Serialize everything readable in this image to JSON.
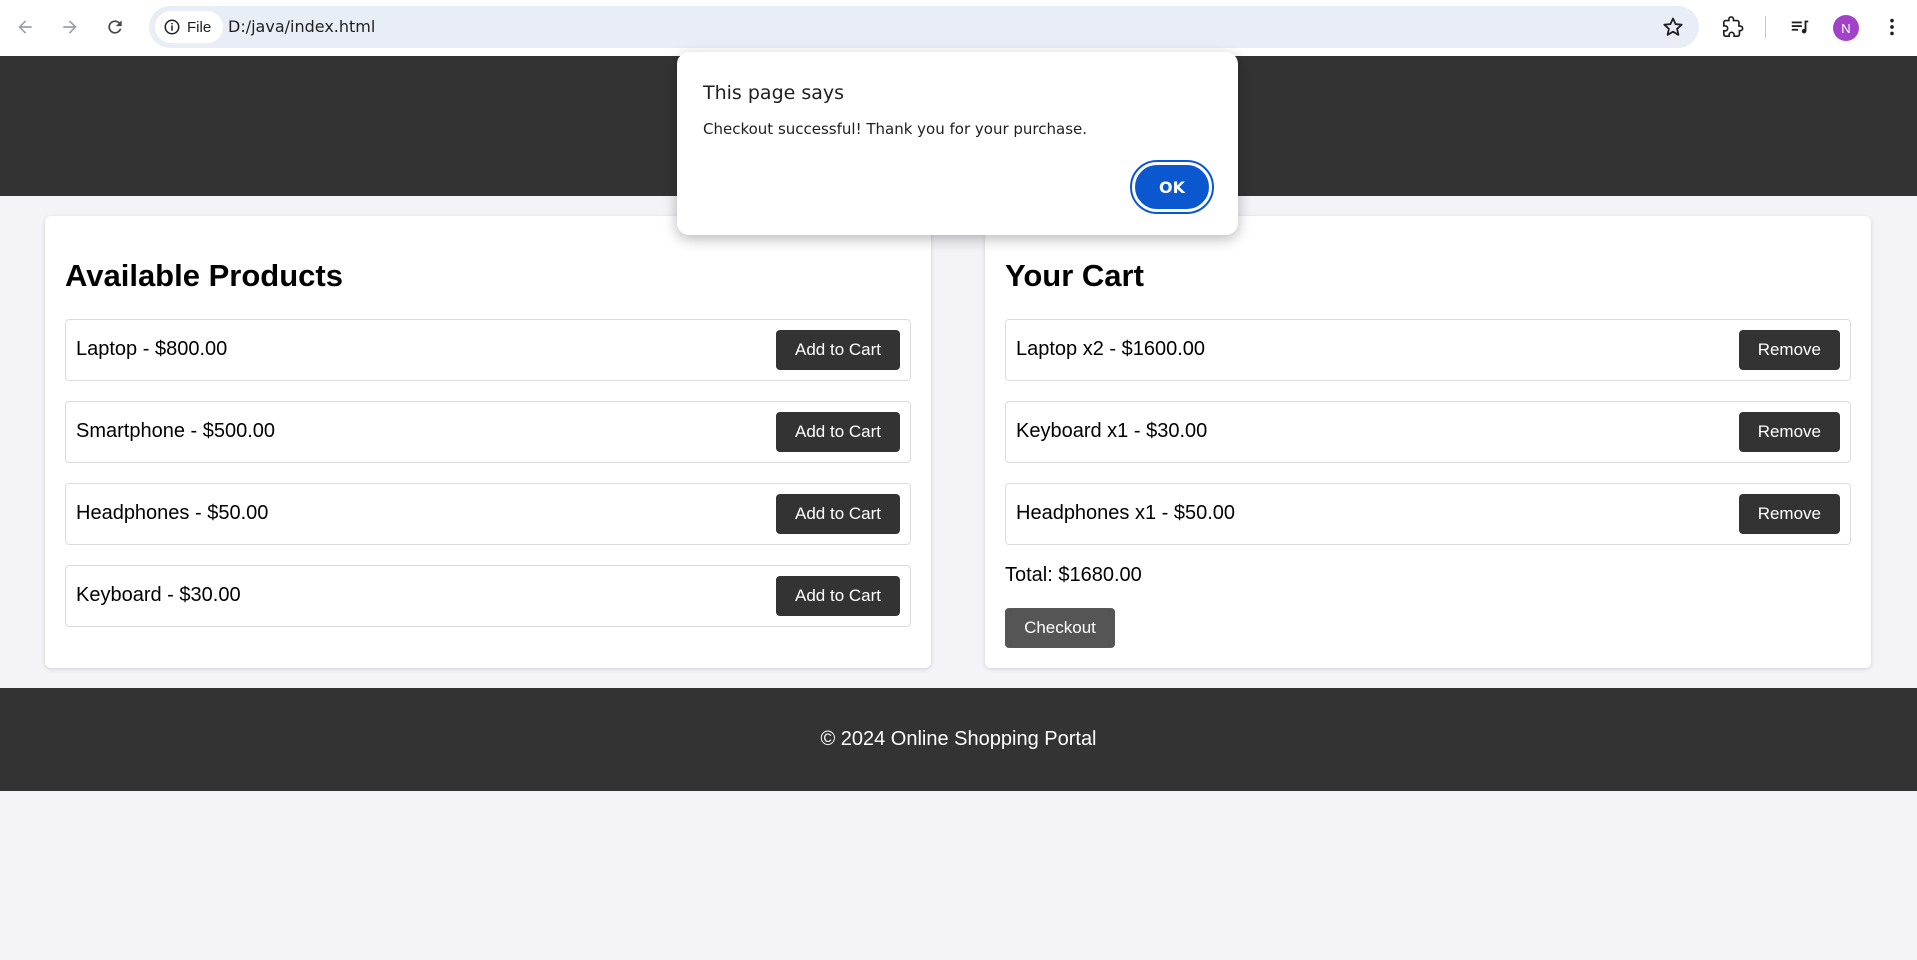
{
  "browser": {
    "site_chip_label": "File",
    "url": "D:/java/index.html",
    "profile_initial": "N"
  },
  "products": {
    "heading": "Available Products",
    "items": [
      {
        "label": "Laptop - $800.00",
        "button": "Add to Cart"
      },
      {
        "label": "Smartphone - $500.00",
        "button": "Add to Cart"
      },
      {
        "label": "Headphones - $50.00",
        "button": "Add to Cart"
      },
      {
        "label": "Keyboard - $30.00",
        "button": "Add to Cart"
      }
    ]
  },
  "cart": {
    "heading": "Your Cart",
    "items": [
      {
        "label": "Laptop x2 - $1600.00",
        "button": "Remove"
      },
      {
        "label": "Keyboard x1 - $30.00",
        "button": "Remove"
      },
      {
        "label": "Headphones x1 - $50.00",
        "button": "Remove"
      }
    ],
    "total": "Total: $1680.00",
    "checkout_label": "Checkout"
  },
  "footer": {
    "text": "© 2024 Online Shopping Portal"
  },
  "dialog": {
    "title": "This page says",
    "message": "Checkout successful! Thank you for your purchase.",
    "ok_label": "OK"
  },
  "colors": {
    "header_bg": "#333333",
    "page_bg": "#f4f4f8",
    "dialog_button": "#0b57d0",
    "avatar": "#a142c9"
  }
}
